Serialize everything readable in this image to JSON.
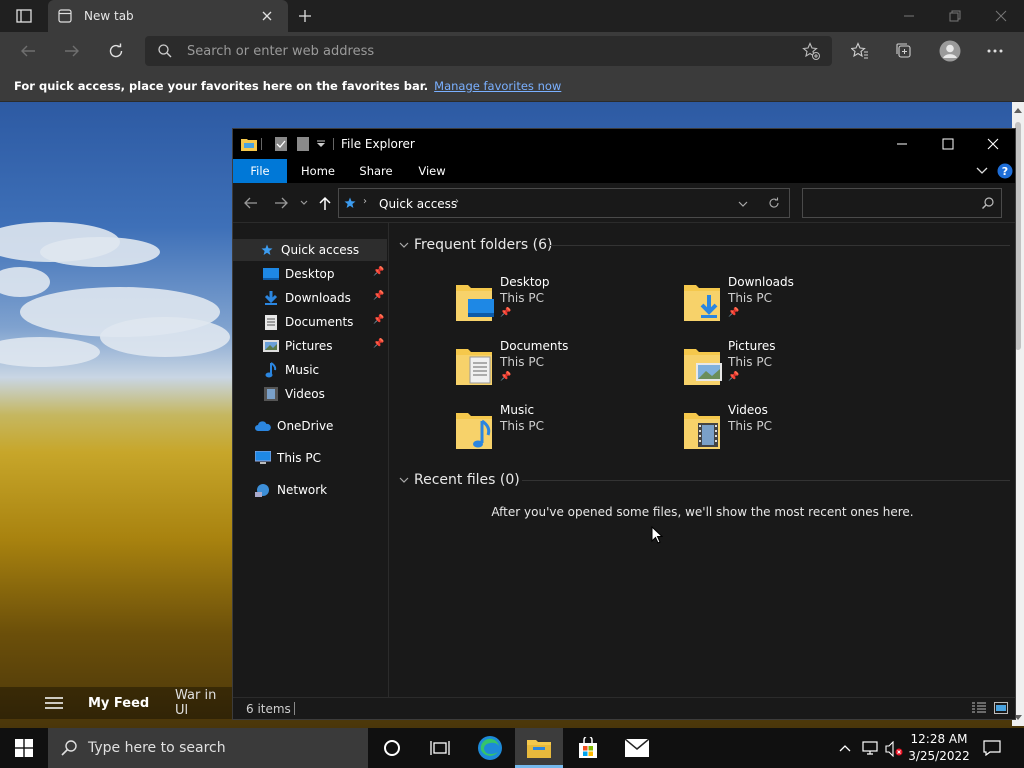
{
  "browser": {
    "tab_title": "New tab",
    "address_placeholder": "Search or enter web address",
    "favbar_text": "For quick access, place your favorites here on the favorites bar.",
    "favbar_link": "Manage favorites now"
  },
  "news": {
    "my_feed": "My Feed",
    "war": "War in Ul"
  },
  "explorer": {
    "title": "File Explorer",
    "ribbon_tabs": [
      "File",
      "Home",
      "Share",
      "View"
    ],
    "breadcrumb": "Quick access",
    "sidebar": {
      "quick_access": "Quick access",
      "items": [
        "Desktop",
        "Downloads",
        "Documents",
        "Pictures",
        "Music",
        "Videos"
      ],
      "onedrive": "OneDrive",
      "this_pc": "This PC",
      "network": "Network"
    },
    "frequent_title": "Frequent folders (6)",
    "folders": [
      {
        "name": "Desktop",
        "location": "This PC"
      },
      {
        "name": "Downloads",
        "location": "This PC"
      },
      {
        "name": "Documents",
        "location": "This PC"
      },
      {
        "name": "Pictures",
        "location": "This PC"
      },
      {
        "name": "Music",
        "location": "This PC"
      },
      {
        "name": "Videos",
        "location": "This PC"
      }
    ],
    "recent_title": "Recent files (0)",
    "recent_empty": "After you've opened some files, we'll show the most recent ones here.",
    "status_items": "6 items"
  },
  "taskbar": {
    "search_placeholder": "Type here to search",
    "time": "12:28 AM",
    "date": "3/25/2022"
  },
  "colors": {
    "accent": "#0078d7",
    "link": "#7ab0ff",
    "folder": "#f5c84c"
  }
}
